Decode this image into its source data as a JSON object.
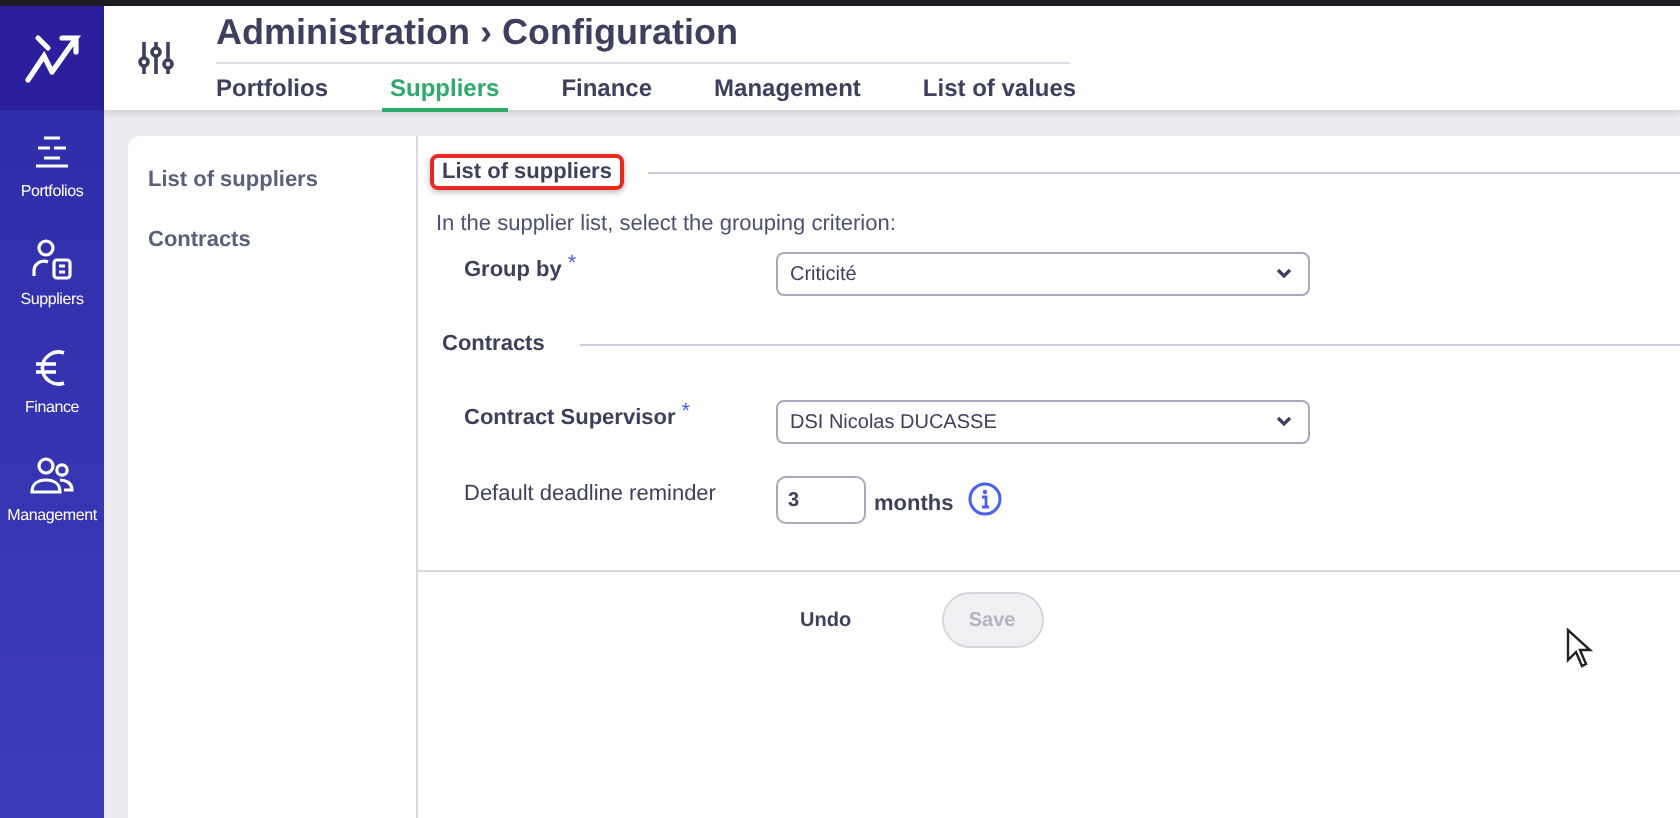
{
  "rail": {
    "items": [
      {
        "label": "Portfolios",
        "kind": "portfolios"
      },
      {
        "label": "Suppliers",
        "kind": "suppliers"
      },
      {
        "label": "Finance",
        "kind": "finance"
      },
      {
        "label": "Management",
        "kind": "management"
      }
    ]
  },
  "header": {
    "title": "Administration › Configuration"
  },
  "tabs": [
    {
      "label": "Portfolios",
      "selected": false
    },
    {
      "label": "Suppliers",
      "selected": true
    },
    {
      "label": "Finance",
      "selected": false
    },
    {
      "label": "Management",
      "selected": false
    },
    {
      "label": "List of values",
      "selected": false
    }
  ],
  "side_nav": {
    "items": [
      "List of suppliers",
      "Contracts"
    ]
  },
  "sections": [
    {
      "title": "List of suppliers",
      "highlighted": true,
      "intro": "In the supplier list, select the grouping criterion:",
      "fields": [
        {
          "kind": "select",
          "label": "Group by",
          "required": true,
          "required_mark": "*",
          "value": "Criticité"
        }
      ]
    },
    {
      "title": "Contracts",
      "highlighted": false,
      "fields": [
        {
          "kind": "select",
          "label": "Contract Supervisor",
          "required": true,
          "required_mark": "*",
          "value": "DSI Nicolas DUCASSE"
        },
        {
          "kind": "number",
          "label": "Default deadline reminder",
          "required": false,
          "value": "3",
          "unit": "months"
        }
      ]
    }
  ],
  "footer": {
    "undo": "Undo",
    "save": {
      "label": "Save",
      "disabled": true
    }
  }
}
